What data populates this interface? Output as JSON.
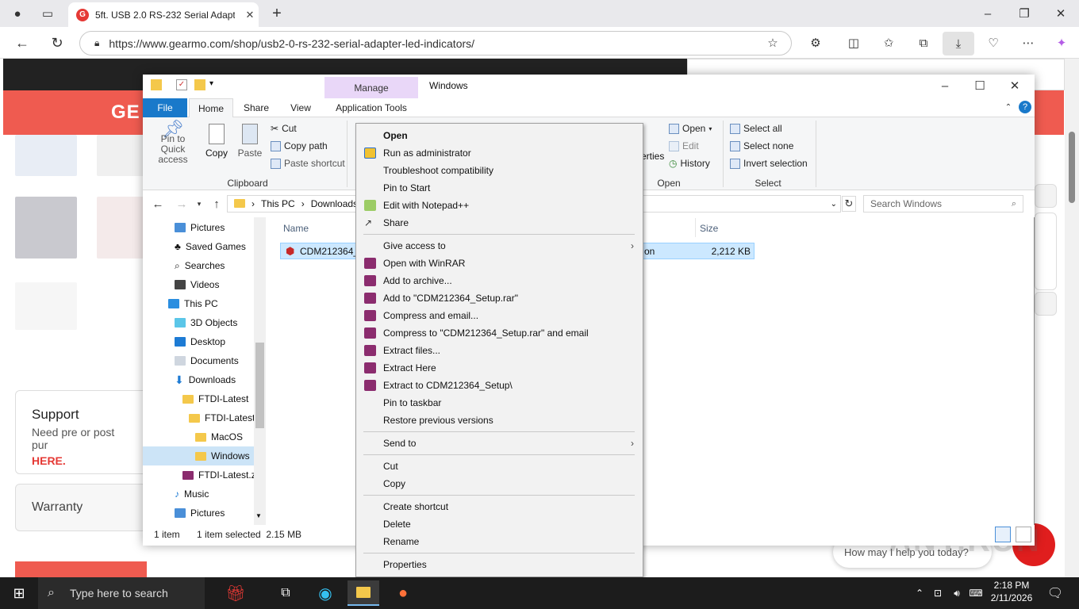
{
  "browser": {
    "tab_title": "5ft. USB 2.0 RS-232 Serial Adapte",
    "url": "https://www.gearmo.com/shop/usb2-0-rs-232-serial-adapter-led-indicators/",
    "colors": {
      "brand": "#ef5b50",
      "header": "#222222"
    }
  },
  "website": {
    "logo": "GE",
    "support_title": "Support",
    "support_text": "Need pre or post pur",
    "support_link": "HERE.",
    "warranty_title": "Warranty",
    "chat_text": "How may I help you today?"
  },
  "explorer": {
    "title": "Windows",
    "manage_label": "Manage",
    "tabs": {
      "file": "File",
      "home": "Home",
      "share": "Share",
      "view": "View",
      "app_tools": "Application Tools"
    },
    "ribbon": {
      "pin_label": "Pin to Quick access",
      "copy_label": "Copy",
      "paste_label": "Paste",
      "cut_label": "Cut",
      "copy_path_label": "Copy path",
      "paste_shortcut_label": "Paste shortcut",
      "clipboard_group": "Clipboard",
      "properties_partial": "erties",
      "open_label": "Open",
      "edit_label": "Edit",
      "history_label": "History",
      "open_group": "Open",
      "select_all": "Select all",
      "select_none": "Select none",
      "invert_selection": "Invert selection",
      "select_group": "Select"
    },
    "path": {
      "this_pc": "This PC",
      "downloads": "Downloads"
    },
    "search_placeholder": "Search Windows",
    "columns": {
      "name": "Name",
      "size": "Size"
    },
    "file": {
      "name": "CDM212364_S",
      "type_partial": "on",
      "size": "2,212 KB"
    },
    "tree": [
      "Pictures",
      "Saved Games",
      "Searches",
      "Videos",
      "This PC",
      "3D Objects",
      "Desktop",
      "Documents",
      "Downloads",
      "FTDI-Latest",
      "FTDI-Latest",
      "MacOS",
      "Windows",
      "FTDI-Latest.zi",
      "Music",
      "Pictures"
    ],
    "status": {
      "count": "1 item",
      "selected": "1 item selected  2.15 MB"
    }
  },
  "context_menu": {
    "items": [
      "Open",
      "Run as administrator",
      "Troubleshoot compatibility",
      "Pin to Start",
      "Edit with Notepad++",
      "Share",
      "Give access to",
      "Open with WinRAR",
      "Add to archive...",
      "Add to \"CDM212364_Setup.rar\"",
      "Compress and email...",
      "Compress to \"CDM212364_Setup.rar\" and email",
      "Extract files...",
      "Extract Here",
      "Extract to CDM212364_Setup\\",
      "Pin to taskbar",
      "Restore previous versions",
      "Send to",
      "Cut",
      "Copy",
      "Create shortcut",
      "Delete",
      "Rename",
      "Properties"
    ]
  },
  "taskbar": {
    "search_placeholder": "Type here to search",
    "time": "2:18 PM",
    "date": "2/11/2026"
  },
  "watermark": "ANY.RUN"
}
